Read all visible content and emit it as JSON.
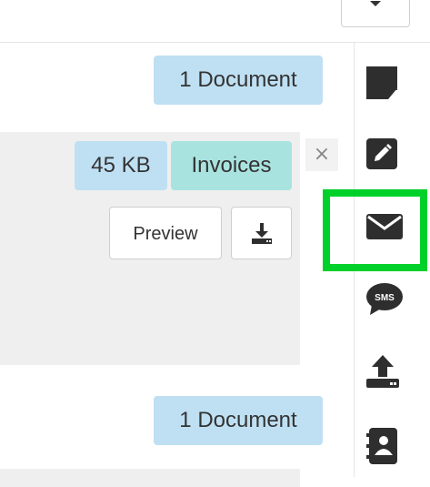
{
  "header": {
    "dropdown_icon": "chevron-down-icon"
  },
  "documents": [
    {
      "count_label": "1 Document",
      "file": {
        "size": "45 KB",
        "folder": "Invoices",
        "preview_label": "Preview",
        "download_icon": "download-icon",
        "close_label": "×"
      }
    },
    {
      "count_label": "1 Document"
    }
  ],
  "rail": {
    "icons": [
      "sticky-note-icon",
      "edit-icon",
      "envelope-icon",
      "sms-icon",
      "upload-icon",
      "address-book-icon"
    ],
    "highlighted": "envelope-icon",
    "highlight_color": "#00d02a"
  },
  "colors": {
    "badge_blue": "#bfe0f3",
    "badge_teal": "#a9e3e0",
    "icon_dark": "#2e2e2e",
    "card_gray": "#efefef"
  }
}
